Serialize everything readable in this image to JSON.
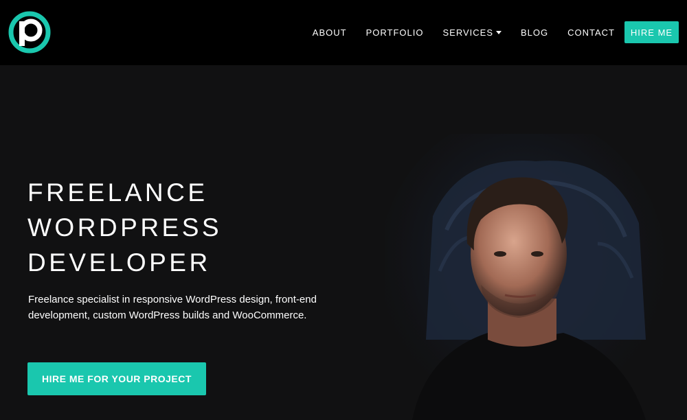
{
  "header": {
    "logo_icon": "p-logo-icon",
    "nav": {
      "about": "ABOUT",
      "portfolio": "PORTFOLIO",
      "services": "SERVICES",
      "blog": "BLOG",
      "contact": "CONTACT",
      "hire_me": "HIRE ME"
    }
  },
  "hero": {
    "title_lines": [
      "FREELANCE",
      "WORDPRESS",
      "DEVELOPER"
    ],
    "description": "Freelance specialist in responsive WordPress design, front-end development, custom WordPress builds and WooCommerce.",
    "cta": "HIRE ME FOR YOUR PROJECT"
  },
  "colors": {
    "accent": "#1ac7ae",
    "header_bg": "#000000",
    "page_bg": "#111112"
  }
}
